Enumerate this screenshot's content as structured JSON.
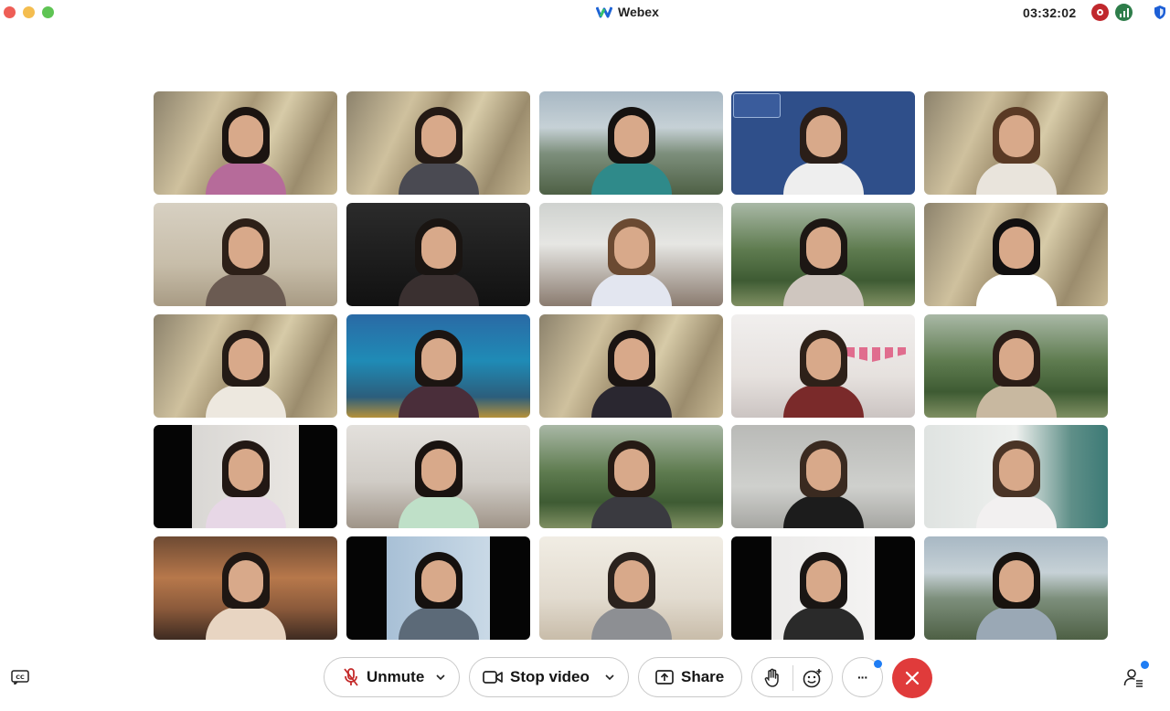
{
  "window": {
    "title": "Webex",
    "clock": "03:32:02"
  },
  "icons": {
    "traffic_close": "close-traffic-light",
    "traffic_minimize": "minimize-traffic-light",
    "traffic_zoom": "zoom-traffic-light",
    "app": "webex-logo-icon",
    "recording": "recording-icon",
    "network": "network-health-icon",
    "security": "shield-icon"
  },
  "grid": {
    "rows": 5,
    "columns": 5,
    "tiles": [
      {
        "bg": "wall"
      },
      {
        "bg": "wall"
      },
      {
        "bg": "mountain"
      },
      {
        "bg": "blue"
      },
      {
        "bg": "wall"
      },
      {
        "bg": "room"
      },
      {
        "bg": "dark"
      },
      {
        "bg": "office"
      },
      {
        "bg": "forest"
      },
      {
        "bg": "wall"
      },
      {
        "bg": "wall"
      },
      {
        "bg": "ocean"
      },
      {
        "bg": "wall"
      },
      {
        "bg": "pink-bunting"
      },
      {
        "bg": "forest"
      },
      {
        "bg": "black-bars"
      },
      {
        "bg": "bedroom"
      },
      {
        "bg": "forest"
      },
      {
        "bg": "grey"
      },
      {
        "bg": "kitchen"
      },
      {
        "bg": "cafe"
      },
      {
        "bg": "sky-bars"
      },
      {
        "bg": "gallery"
      },
      {
        "bg": "white-bars"
      },
      {
        "bg": "mountain"
      }
    ]
  },
  "toolbar": {
    "unmute_label": "Unmute",
    "stop_video_label": "Stop video",
    "share_label": "Share",
    "more_label": "···"
  },
  "colors": {
    "leave": "#e03b3b",
    "recording": "#c0282d",
    "network": "#2e7d4a",
    "notification": "#1f7df4"
  }
}
